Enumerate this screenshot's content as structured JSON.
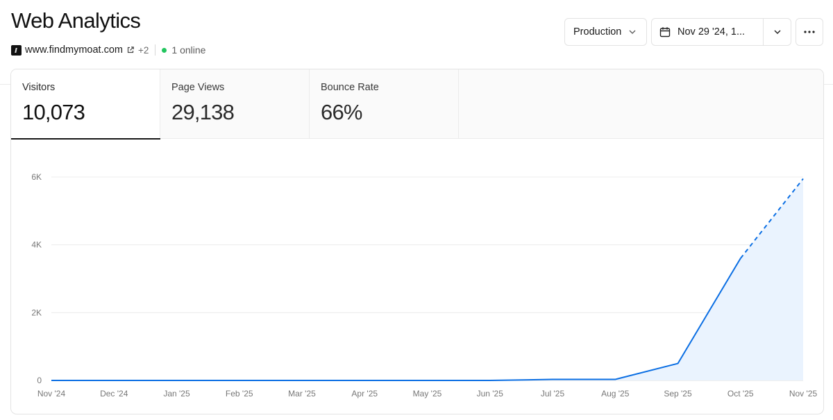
{
  "header": {
    "title": "Web Analytics",
    "site": {
      "domain": "www.findmymoat.com",
      "more_count": "+2",
      "online_text": "1 online"
    }
  },
  "controls": {
    "environment": "Production",
    "date_range": "Nov 29 '24, 1..."
  },
  "tabs": [
    {
      "label": "Visitors",
      "value": "10,073",
      "active": true
    },
    {
      "label": "Page Views",
      "value": "29,138",
      "active": false
    },
    {
      "label": "Bounce Rate",
      "value": "66%",
      "active": false
    }
  ],
  "chart_data": {
    "type": "area",
    "categories": [
      "Nov '24",
      "Dec '24",
      "Jan '25",
      "Feb '25",
      "Mar '25",
      "Apr '25",
      "May '25",
      "Jun '25",
      "Jul '25",
      "Aug '25",
      "Sep '25",
      "Oct '25",
      "Nov '25"
    ],
    "values": [
      0,
      0,
      0,
      0,
      0,
      0,
      0,
      0,
      30,
      30,
      500,
      3600,
      5950
    ],
    "projected_from_index": 11,
    "yticks": [
      0,
      2000,
      4000,
      6000
    ],
    "ytick_labels": [
      "0",
      "2K",
      "4K",
      "6K"
    ],
    "ylim": [
      0,
      6000
    ],
    "grid": true,
    "legend": "none",
    "line_color": "#0a6ee3",
    "fill_color": "#eaf3fe"
  },
  "colors": {
    "online_dot": "#22c55e",
    "accent": "#0a6ee3"
  },
  "icons": {
    "favicon": "site-favicon-icon",
    "external": "external-link-icon",
    "calendar": "calendar-icon",
    "chevron": "chevron-down-icon",
    "more": "more-horizontal-icon"
  }
}
